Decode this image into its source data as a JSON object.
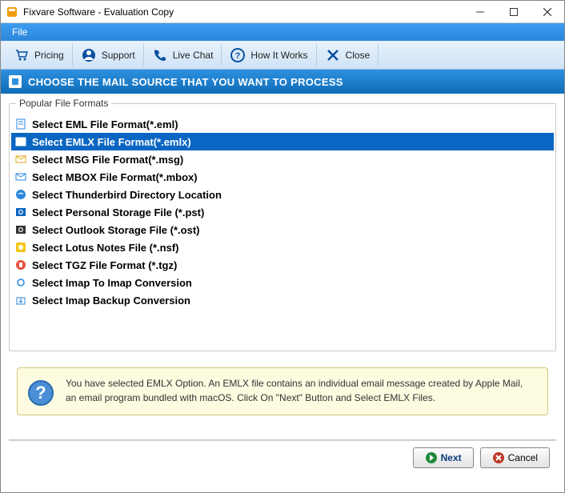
{
  "window": {
    "title": "Fixvare Software - Evaluation Copy"
  },
  "menubar": {
    "file": "File"
  },
  "toolbar": {
    "pricing": "Pricing",
    "support": "Support",
    "livechat": "Live Chat",
    "howitworks": "How It Works",
    "close": "Close"
  },
  "headline": "CHOOSE THE MAIL SOURCE THAT YOU WANT TO PROCESS",
  "group_legend": "Popular File Formats",
  "list_items": {
    "0": "Select EML File Format(*.eml)",
    "1": "Select EMLX File Format(*.emlx)",
    "2": "Select MSG File Format(*.msg)",
    "3": "Select MBOX File Format(*.mbox)",
    "4": "Select Thunderbird Directory Location",
    "5": "Select Personal Storage File (*.pst)",
    "6": "Select Outlook Storage File (*.ost)",
    "7": "Select Lotus Notes File (*.nsf)",
    "8": "Select TGZ File Format (*.tgz)",
    "9": "Select Imap To Imap Conversion",
    "10": "Select Imap Backup Conversion"
  },
  "selected_index": 1,
  "info_text": "You have selected EMLX Option. An EMLX file contains an individual email message created by Apple Mail, an email program bundled with macOS. Click On \"Next\" Button and Select EMLX Files.",
  "buttons": {
    "next": "Next",
    "cancel": "Cancel"
  }
}
